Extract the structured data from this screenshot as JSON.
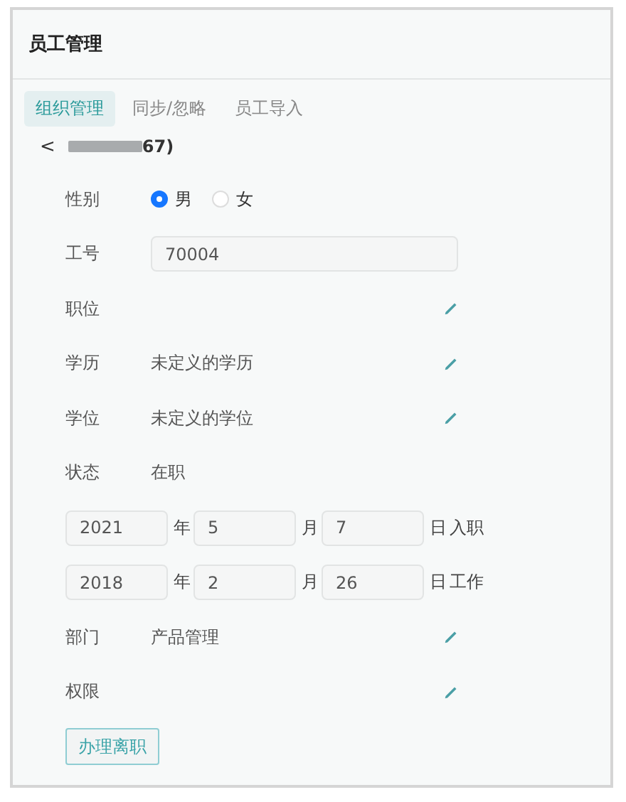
{
  "window": {
    "title": "员工管理"
  },
  "tabs": [
    {
      "label": "组织管理",
      "selected": true
    },
    {
      "label": "同步/忽略",
      "selected": false
    },
    {
      "label": "员工导入",
      "selected": false
    }
  ],
  "back": {
    "icon": "<",
    "name": "67)",
    "redacted": true
  },
  "fields": [
    {
      "kind": "radio",
      "label": "性别",
      "options": [
        {
          "label": "男",
          "selected": true
        },
        {
          "label": "女",
          "selected": false
        }
      ]
    },
    {
      "kind": "input",
      "label": "工号",
      "value": "70004"
    },
    {
      "kind": "edit",
      "label": "职位"
    },
    {
      "kind": "edit",
      "label": "学历",
      "value": "未定义的学历"
    },
    {
      "kind": "edit",
      "label": "学位",
      "value": "未定义的学位"
    },
    {
      "kind": "text",
      "label": "状态",
      "value": "在职"
    },
    {
      "kind": "date",
      "year": "2021",
      "year_unit": "年",
      "month": "5",
      "month_unit": "月",
      "day": "7",
      "day_unit": "日",
      "suffix": "入职"
    },
    {
      "kind": "date",
      "year": "2018",
      "year_unit": "年",
      "month": "2",
      "month_unit": "月",
      "day": "26",
      "day_unit": "日",
      "suffix": "工作"
    },
    {
      "kind": "edit",
      "label": "部门",
      "value": "产品管理"
    },
    {
      "kind": "edit",
      "label": "权限"
    }
  ],
  "button": "办理离职"
}
